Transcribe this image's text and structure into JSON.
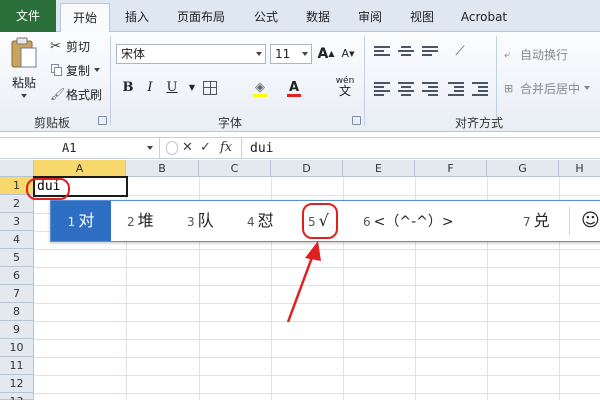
{
  "tabs": [
    "文件",
    "开始",
    "插入",
    "页面布局",
    "公式",
    "数据",
    "审阅",
    "视图",
    "Acrobat"
  ],
  "clipboard": {
    "paste": "粘贴",
    "cut": "剪切",
    "copy": "复制",
    "format_painter": "格式刷",
    "label": "剪贴板"
  },
  "font": {
    "name": "宋体",
    "size": "11",
    "grow": "A",
    "shrink": "A",
    "bold": "B",
    "italic": "I",
    "underline": "U",
    "color_a": "A",
    "phonetic": "wén",
    "label": "字体"
  },
  "alignment": {
    "wrap": "自动换行",
    "merge": "合并后居中",
    "label": "对齐方式"
  },
  "formula_bar": {
    "name_box": "A1",
    "cancel": "✕",
    "enter": "✓",
    "fx": "fx",
    "value": "dui"
  },
  "grid": {
    "columns": [
      "A",
      "B",
      "C",
      "D",
      "E",
      "F",
      "G",
      "H"
    ],
    "rows": [
      "1",
      "2",
      "3",
      "4",
      "5",
      "6",
      "7",
      "8",
      "9",
      "10",
      "11",
      "12",
      "13"
    ],
    "a1_value": "dui"
  },
  "ime": {
    "candidates": [
      {
        "num": "1",
        "text": "对"
      },
      {
        "num": "2",
        "text": "堆"
      },
      {
        "num": "3",
        "text": "队"
      },
      {
        "num": "4",
        "text": "怼"
      },
      {
        "num": "5",
        "text": "√"
      },
      {
        "num": "6",
        "text": "<（^-^）>"
      },
      {
        "num": "7",
        "text": "兑"
      }
    ],
    "emoji": "☺"
  },
  "colors": {
    "accent": "#2f6fc3",
    "file_tab": "#2a6f3a",
    "highlight_ring": "#e02020",
    "selected_header": "#f7d86d"
  }
}
